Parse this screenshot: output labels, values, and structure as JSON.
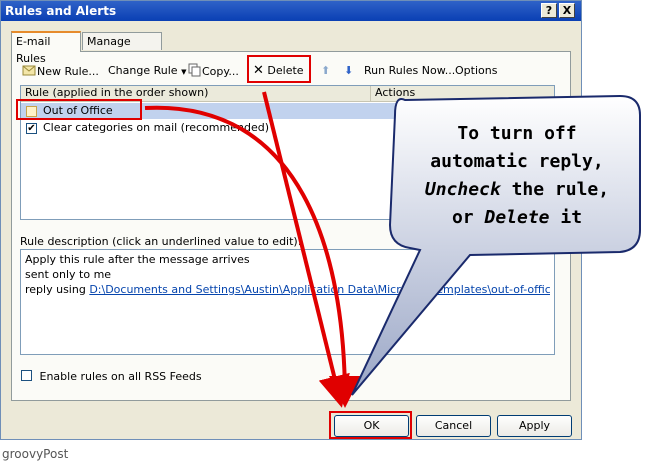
{
  "window": {
    "title": "Rules and Alerts",
    "help_btn": "?",
    "close_btn": "X"
  },
  "tabs": [
    {
      "label": "E-mail Rules"
    },
    {
      "label": "Manage Alerts"
    }
  ],
  "toolbar": {
    "new_rule": "New Rule...",
    "change_rule": "Change Rule",
    "copy": "Copy...",
    "delete": "Delete",
    "run_rules": "Run Rules Now...",
    "options": "Options"
  },
  "rules_list": {
    "columns": [
      "Rule (applied in the order shown)",
      "Actions"
    ],
    "rows": [
      {
        "name": "Out of Office",
        "checked": false
      },
      {
        "name": "Clear categories on mail (recommended)",
        "checked": true
      }
    ]
  },
  "description": {
    "label": "Rule description (click an underlined value to edit):",
    "line1": "Apply this rule after the message arrives",
    "line2": "sent only to me",
    "line3_prefix": "reply using ",
    "line3_link": "D:\\Documents and Settings\\Austin\\Application Data\\Microsoft\\Templates\\out-of-office.oft"
  },
  "rss": {
    "label": "Enable rules on all RSS Feeds",
    "checked": false
  },
  "buttons": {
    "ok": "OK",
    "cancel": "Cancel",
    "apply": "Apply"
  },
  "callout": {
    "line1": "To turn off",
    "line2": "automatic reply,",
    "line3_em": "Uncheck",
    "line3_rest": " the rule,",
    "line4_pre": "or ",
    "line4_em": "Delete",
    "line4_post": " it"
  },
  "credit": "groovyPost",
  "colors": {
    "annotation_red": "#e00000",
    "titlebar": "#0a3fb4",
    "selected_row": "#c1d2ee"
  }
}
